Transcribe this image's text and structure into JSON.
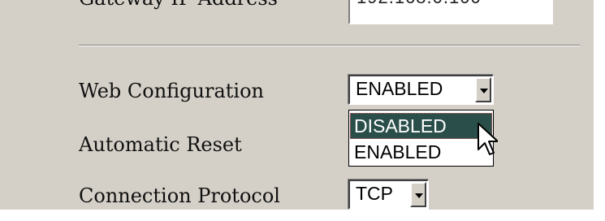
{
  "form": {
    "gateway_label": "Gateway IP Address",
    "gateway_value": "192.168.0.100",
    "web_config": {
      "label": "Web Configuration",
      "selected": "ENABLED",
      "options": [
        "DISABLED",
        "ENABLED"
      ],
      "highlighted": "DISABLED",
      "dropdown_open": true
    },
    "automatic_reset": {
      "label": "Automatic Reset"
    },
    "connection_protocol": {
      "label": "Connection Protocol",
      "selected": "TCP"
    }
  },
  "colors": {
    "background": "#d4d0c8",
    "highlight": "#2a4f4a"
  },
  "icons": {
    "dropdown_arrow": "triangle-down",
    "cursor": "mouse-pointer-arrow"
  }
}
